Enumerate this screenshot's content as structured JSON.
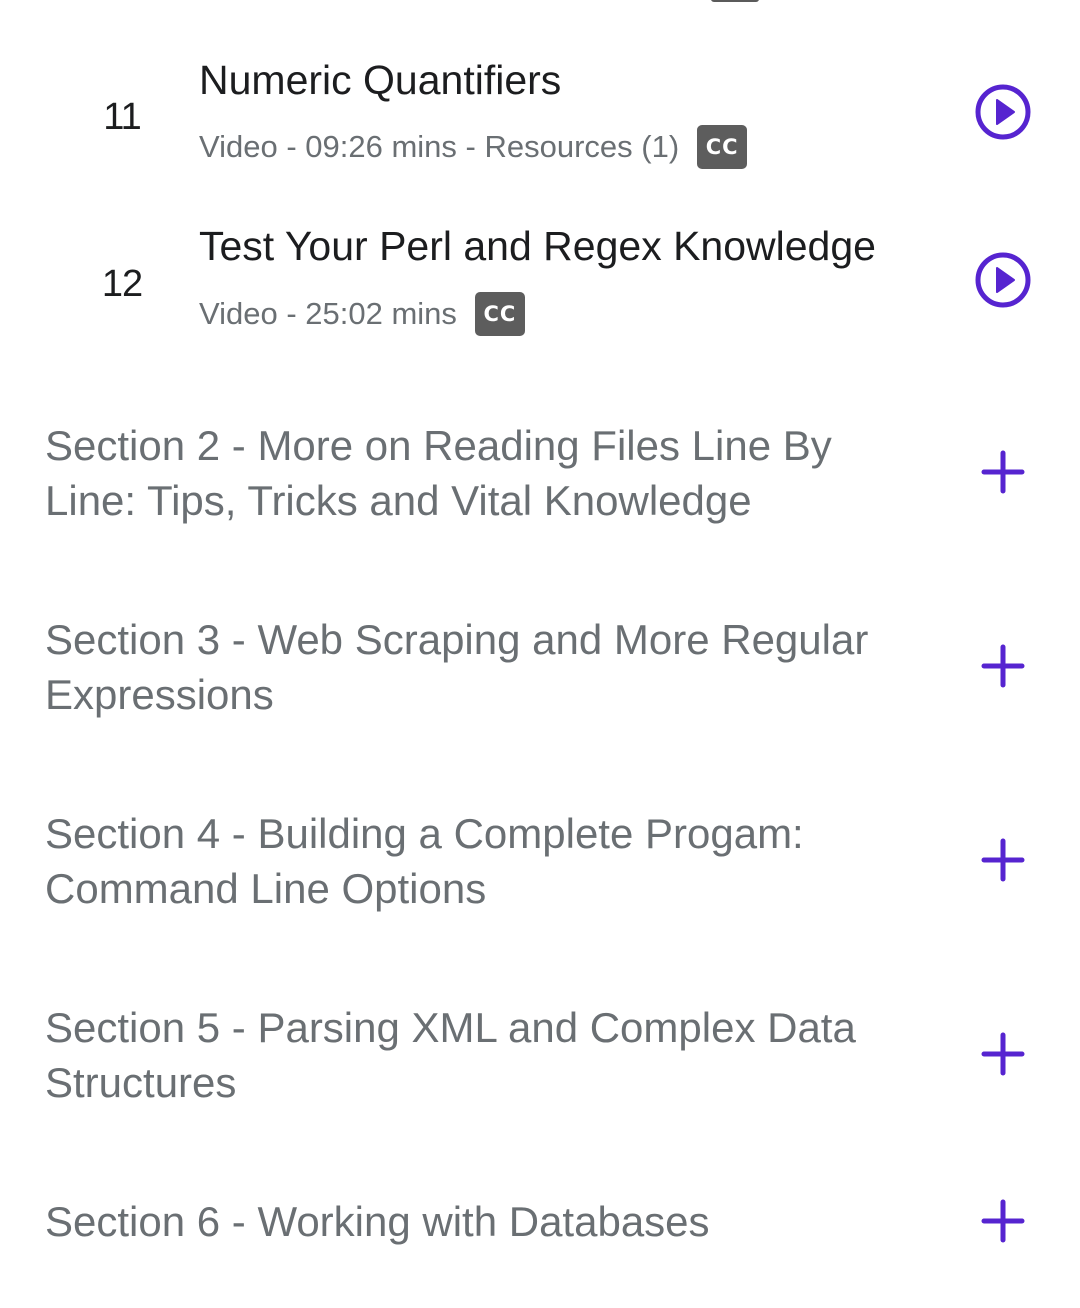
{
  "lectures": [
    {
      "number": "11",
      "title": "Numeric Quantifiers",
      "meta": "Video - 09:26 mins - Resources (1)",
      "cc_label": "CC",
      "icon": "play-circle-icon"
    },
    {
      "number": "12",
      "title": "Test Your Perl and Regex Knowledge",
      "meta": "Video - 25:02 mins",
      "cc_label": "CC",
      "icon": "play-circle-icon"
    }
  ],
  "sections": [
    {
      "title": "Section 2 - More on Reading Files Line By Line: Tips, Tricks and Vital Knowledge",
      "icon": "plus-icon"
    },
    {
      "title": "Section 3 - Web Scraping and More Regular Expressions",
      "icon": "plus-icon"
    },
    {
      "title": "Section 4 - Building a Complete Progam: Command Line Options",
      "icon": "plus-icon"
    },
    {
      "title": "Section 5 - Parsing XML and Complex Data Structures",
      "icon": "plus-icon"
    },
    {
      "title": "Section 6 - Working with Databases",
      "icon": "plus-icon"
    }
  ],
  "colors": {
    "accent": "#5624d0",
    "title_text": "#1c1d1f",
    "muted_text": "#6a6f73",
    "cc_badge_bg": "#5d5d5d"
  }
}
